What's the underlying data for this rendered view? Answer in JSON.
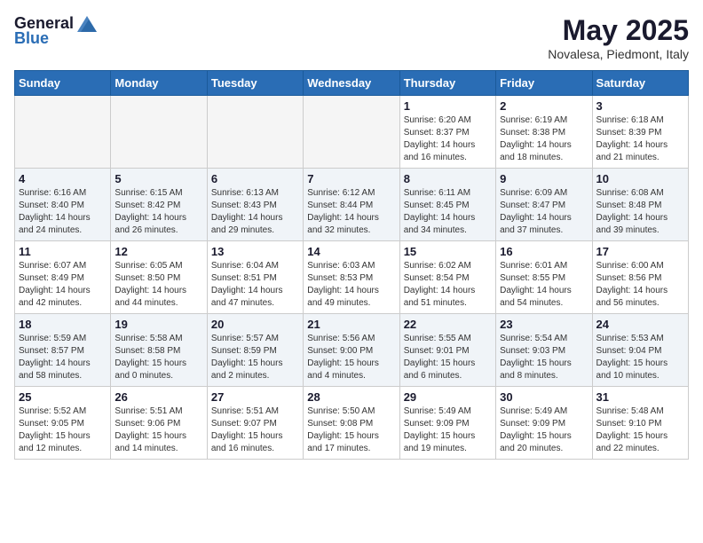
{
  "header": {
    "logo_general": "General",
    "logo_blue": "Blue",
    "month_title": "May 2025",
    "location": "Novalesa, Piedmont, Italy"
  },
  "days_of_week": [
    "Sunday",
    "Monday",
    "Tuesday",
    "Wednesday",
    "Thursday",
    "Friday",
    "Saturday"
  ],
  "weeks": [
    [
      {
        "day": "",
        "info": ""
      },
      {
        "day": "",
        "info": ""
      },
      {
        "day": "",
        "info": ""
      },
      {
        "day": "",
        "info": ""
      },
      {
        "day": "1",
        "info": "Sunrise: 6:20 AM\nSunset: 8:37 PM\nDaylight: 14 hours\nand 16 minutes."
      },
      {
        "day": "2",
        "info": "Sunrise: 6:19 AM\nSunset: 8:38 PM\nDaylight: 14 hours\nand 18 minutes."
      },
      {
        "day": "3",
        "info": "Sunrise: 6:18 AM\nSunset: 8:39 PM\nDaylight: 14 hours\nand 21 minutes."
      }
    ],
    [
      {
        "day": "4",
        "info": "Sunrise: 6:16 AM\nSunset: 8:40 PM\nDaylight: 14 hours\nand 24 minutes."
      },
      {
        "day": "5",
        "info": "Sunrise: 6:15 AM\nSunset: 8:42 PM\nDaylight: 14 hours\nand 26 minutes."
      },
      {
        "day": "6",
        "info": "Sunrise: 6:13 AM\nSunset: 8:43 PM\nDaylight: 14 hours\nand 29 minutes."
      },
      {
        "day": "7",
        "info": "Sunrise: 6:12 AM\nSunset: 8:44 PM\nDaylight: 14 hours\nand 32 minutes."
      },
      {
        "day": "8",
        "info": "Sunrise: 6:11 AM\nSunset: 8:45 PM\nDaylight: 14 hours\nand 34 minutes."
      },
      {
        "day": "9",
        "info": "Sunrise: 6:09 AM\nSunset: 8:47 PM\nDaylight: 14 hours\nand 37 minutes."
      },
      {
        "day": "10",
        "info": "Sunrise: 6:08 AM\nSunset: 8:48 PM\nDaylight: 14 hours\nand 39 minutes."
      }
    ],
    [
      {
        "day": "11",
        "info": "Sunrise: 6:07 AM\nSunset: 8:49 PM\nDaylight: 14 hours\nand 42 minutes."
      },
      {
        "day": "12",
        "info": "Sunrise: 6:05 AM\nSunset: 8:50 PM\nDaylight: 14 hours\nand 44 minutes."
      },
      {
        "day": "13",
        "info": "Sunrise: 6:04 AM\nSunset: 8:51 PM\nDaylight: 14 hours\nand 47 minutes."
      },
      {
        "day": "14",
        "info": "Sunrise: 6:03 AM\nSunset: 8:53 PM\nDaylight: 14 hours\nand 49 minutes."
      },
      {
        "day": "15",
        "info": "Sunrise: 6:02 AM\nSunset: 8:54 PM\nDaylight: 14 hours\nand 51 minutes."
      },
      {
        "day": "16",
        "info": "Sunrise: 6:01 AM\nSunset: 8:55 PM\nDaylight: 14 hours\nand 54 minutes."
      },
      {
        "day": "17",
        "info": "Sunrise: 6:00 AM\nSunset: 8:56 PM\nDaylight: 14 hours\nand 56 minutes."
      }
    ],
    [
      {
        "day": "18",
        "info": "Sunrise: 5:59 AM\nSunset: 8:57 PM\nDaylight: 14 hours\nand 58 minutes."
      },
      {
        "day": "19",
        "info": "Sunrise: 5:58 AM\nSunset: 8:58 PM\nDaylight: 15 hours\nand 0 minutes."
      },
      {
        "day": "20",
        "info": "Sunrise: 5:57 AM\nSunset: 8:59 PM\nDaylight: 15 hours\nand 2 minutes."
      },
      {
        "day": "21",
        "info": "Sunrise: 5:56 AM\nSunset: 9:00 PM\nDaylight: 15 hours\nand 4 minutes."
      },
      {
        "day": "22",
        "info": "Sunrise: 5:55 AM\nSunset: 9:01 PM\nDaylight: 15 hours\nand 6 minutes."
      },
      {
        "day": "23",
        "info": "Sunrise: 5:54 AM\nSunset: 9:03 PM\nDaylight: 15 hours\nand 8 minutes."
      },
      {
        "day": "24",
        "info": "Sunrise: 5:53 AM\nSunset: 9:04 PM\nDaylight: 15 hours\nand 10 minutes."
      }
    ],
    [
      {
        "day": "25",
        "info": "Sunrise: 5:52 AM\nSunset: 9:05 PM\nDaylight: 15 hours\nand 12 minutes."
      },
      {
        "day": "26",
        "info": "Sunrise: 5:51 AM\nSunset: 9:06 PM\nDaylight: 15 hours\nand 14 minutes."
      },
      {
        "day": "27",
        "info": "Sunrise: 5:51 AM\nSunset: 9:07 PM\nDaylight: 15 hours\nand 16 minutes."
      },
      {
        "day": "28",
        "info": "Sunrise: 5:50 AM\nSunset: 9:08 PM\nDaylight: 15 hours\nand 17 minutes."
      },
      {
        "day": "29",
        "info": "Sunrise: 5:49 AM\nSunset: 9:09 PM\nDaylight: 15 hours\nand 19 minutes."
      },
      {
        "day": "30",
        "info": "Sunrise: 5:49 AM\nSunset: 9:09 PM\nDaylight: 15 hours\nand 20 minutes."
      },
      {
        "day": "31",
        "info": "Sunrise: 5:48 AM\nSunset: 9:10 PM\nDaylight: 15 hours\nand 22 minutes."
      }
    ]
  ]
}
